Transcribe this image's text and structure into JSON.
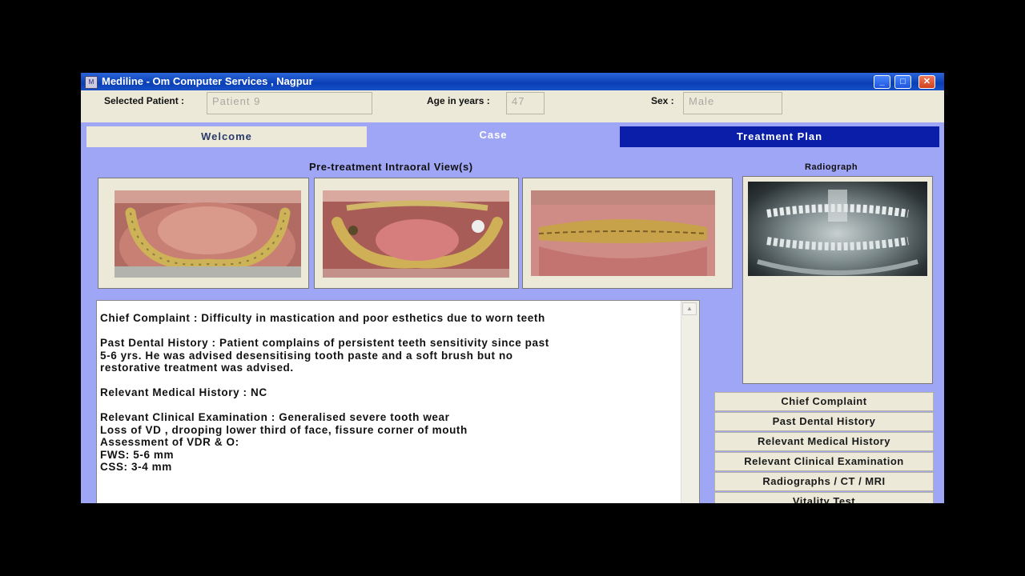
{
  "window": {
    "title": "Mediline  -  Om Computer Services  , Nagpur",
    "icon": "app-icon",
    "controls": {
      "minimize": "_",
      "maximize": "□",
      "close": "✕"
    }
  },
  "patient": {
    "selected_label": "Selected Patient :",
    "selected_value": "Patient  9",
    "age_label": "Age in years :",
    "age_value": "47",
    "sex_label": "Sex :",
    "sex_value": "Male"
  },
  "tabs": [
    {
      "label": "Welcome",
      "active": false
    },
    {
      "label": "Case",
      "active": true
    },
    {
      "label": "Treatment Plan",
      "active": false
    }
  ],
  "case": {
    "intraoral_title": "Pre-treatment Intraoral View(s)",
    "radiograph_title": "Radiograph",
    "notes": "Chief Complaint : Difficulty in mastication and poor esthetics due to worn teeth\n\nPast Dental History : Patient complains of persistent teeth sensitivity since past\n5-6 yrs. He was advised desensitising tooth paste and a soft brush but no\nrestorative treatment was advised.\n\nRelevant Medical History : NC\n\nRelevant Clinical Examination : Generalised severe tooth wear\nLoss of VD , drooping lower third of face, fissure corner of mouth\nAssessment of VDR & O:\nFWS: 5-6 mm\nCSS: 3-4 mm"
  },
  "side_buttons": [
    "Chief Complaint",
    "Past Dental History",
    "Relevant Medical History",
    "Relevant Clinical  Examination",
    "Radiographs / CT / MRI",
    "Vitality Test"
  ],
  "colors": {
    "window_bg": "#a0a6f6",
    "panel_bg": "#ece9d8",
    "active_tab": "#0b1eaa",
    "titlebar": "#0a3fb6"
  }
}
